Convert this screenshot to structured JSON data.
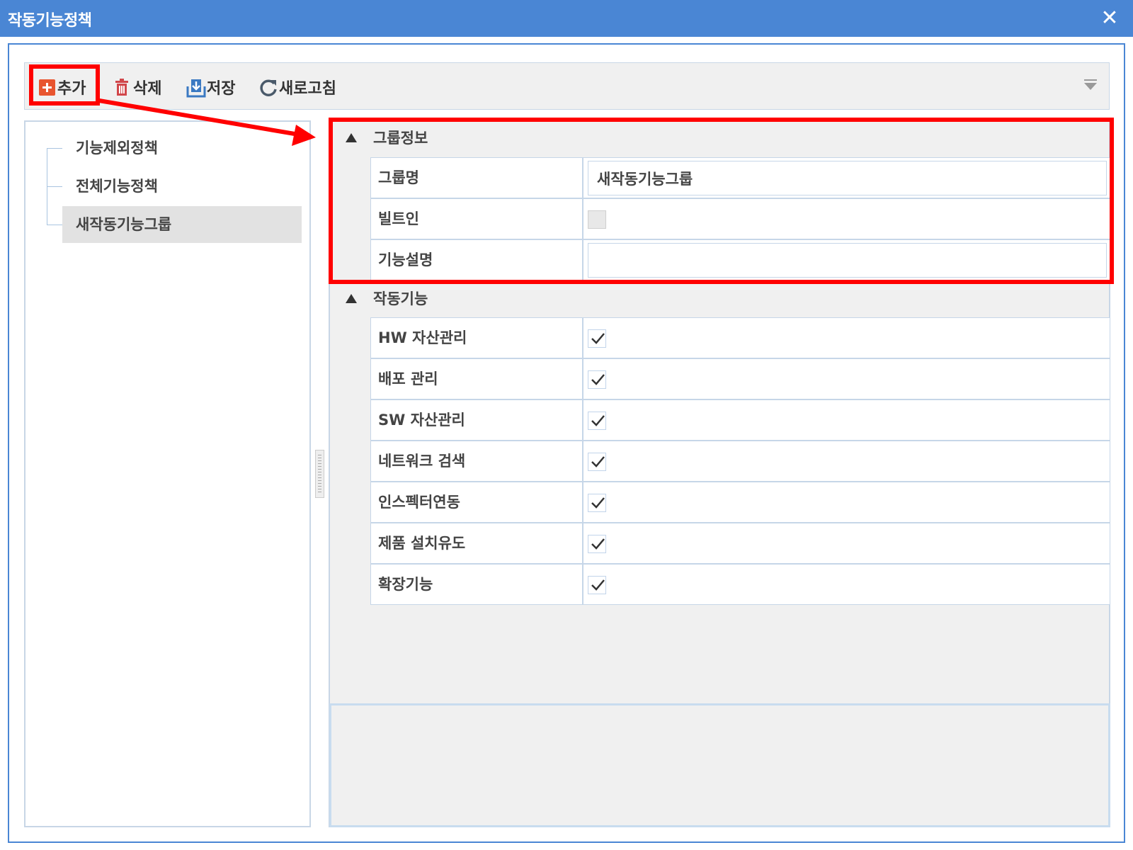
{
  "window": {
    "title": "작동기능정책",
    "close_glyph": "✕"
  },
  "toolbar": {
    "add_label": "추가",
    "delete_label": "삭제",
    "save_label": "저장",
    "refresh_label": "새로고침",
    "icons": {
      "add": "plus-square-icon",
      "delete": "trash-icon",
      "save": "download-icon",
      "refresh": "refresh-icon",
      "menu": "filter-menu-icon"
    },
    "colors": {
      "add_icon": "#e8552f",
      "delete_icon": "#d1464a",
      "save_icon": "#3a79c2",
      "refresh_icon": "#4a5a6a"
    }
  },
  "tree": {
    "items": [
      {
        "label": "기능제외정책",
        "selected": false
      },
      {
        "label": "전체기능정책",
        "selected": false
      },
      {
        "label": "새작동기능그룹",
        "selected": true
      }
    ]
  },
  "group_info": {
    "title": "그룹정보",
    "fields": {
      "name_label": "그룹명",
      "name_value": "새작동기능그룹",
      "builtin_label": "빌트인",
      "builtin_checked": false,
      "description_label": "기능설명",
      "description_value": ""
    }
  },
  "features": {
    "title": "작동기능",
    "items": [
      {
        "label": "HW 자산관리",
        "checked": true
      },
      {
        "label": "배포 관리",
        "checked": true
      },
      {
        "label": "SW 자산관리",
        "checked": true
      },
      {
        "label": "네트워크 검색",
        "checked": true
      },
      {
        "label": "인스펙터연동",
        "checked": true
      },
      {
        "label": "제품 설치유도",
        "checked": true
      },
      {
        "label": "확장기능",
        "checked": true
      }
    ]
  },
  "annotation": {
    "color": "#ff0000"
  },
  "theme": {
    "titlebar": "#4a86d4",
    "panel_bg": "#f0f0f0",
    "border": "#c8d6e6"
  }
}
